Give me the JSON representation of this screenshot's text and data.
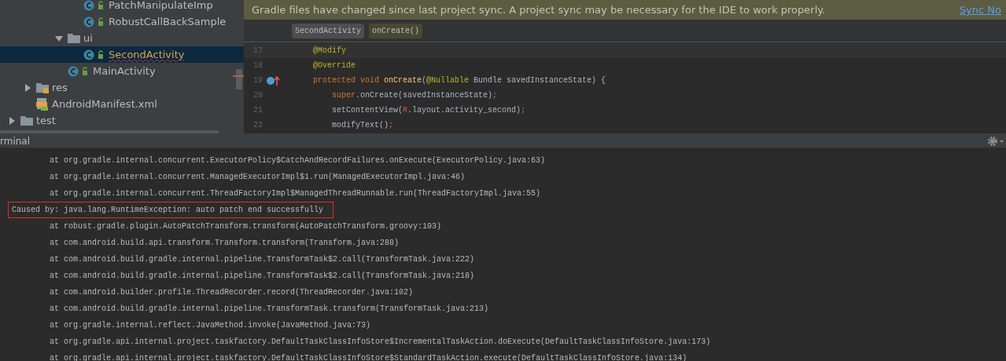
{
  "project_tree": {
    "items": [
      {
        "children": [
          {
            "children": [
              {
                "children": [
                  {
                    "children": [
                      {
                        "kind": "class",
                        "label": "PatchManipulateImp",
                        "selected": false
                      },
                      {
                        "kind": "class",
                        "label": "RobustCallBackSample",
                        "selected": false
                      }
                    ]
                  },
                  {
                    "kind": "folder",
                    "label": "ui",
                    "expanded": true,
                    "selected": false,
                    "children": [
                      {
                        "kind": "class",
                        "label": "SecondActivity",
                        "selected": true
                      }
                    ]
                  },
                  {
                    "kind": "class",
                    "label": "MainActivity",
                    "selected": false
                  }
                ]
              }
            ]
          },
          {
            "kind": "res",
            "label": "res",
            "expanded": false,
            "selected": false
          },
          {
            "kind": "manifest",
            "label": "AndroidManifest.xml",
            "selected": false
          }
        ]
      },
      {
        "kind": "folder",
        "label": "test",
        "expanded": false,
        "selected": false
      }
    ]
  },
  "banner": {
    "message": "Gradle files have changed since last project sync. A project sync may be necessary for the IDE to work properly.",
    "link": "Sync No"
  },
  "breadcrumbs": [
    {
      "kind": "class",
      "label": "SecondActivity"
    },
    {
      "kind": "method",
      "label": "onCreate()"
    }
  ],
  "code_lines": [
    {
      "number": "17",
      "current": true,
      "indented": false,
      "gutter_icon": false,
      "tokens": [
        {
          "kind": "annotation",
          "text": "@Modify"
        }
      ]
    },
    {
      "number": "18",
      "current": false,
      "indented": false,
      "gutter_icon": false,
      "tokens": [
        {
          "kind": "annotation",
          "text": "@Override"
        }
      ]
    },
    {
      "number": "19",
      "current": false,
      "indented": false,
      "gutter_icon": true,
      "tokens": [
        {
          "kind": "keyword",
          "text": "protected void "
        },
        {
          "kind": "method",
          "text": "onCreate"
        },
        {
          "kind": "plain",
          "text": "("
        },
        {
          "kind": "annotation",
          "text": "@Nullable"
        },
        {
          "kind": "plain",
          "text": " Bundle savedInstanceState) {"
        }
      ]
    },
    {
      "number": "20",
      "current": false,
      "indented": true,
      "gutter_icon": false,
      "tokens": [
        {
          "kind": "keyword",
          "text": "super"
        },
        {
          "kind": "plain",
          "text": ".onCreate(savedInstanceState)"
        },
        {
          "kind": "keyword",
          "text": ";"
        }
      ]
    },
    {
      "number": "21",
      "current": false,
      "indented": true,
      "gutter_icon": false,
      "tokens": [
        {
          "kind": "plain",
          "text": "setContentView("
        },
        {
          "kind": "error",
          "text": "R"
        },
        {
          "kind": "plain",
          "text": ".layout.activity_second)"
        },
        {
          "kind": "keyword",
          "text": ";"
        }
      ]
    },
    {
      "number": "22",
      "current": false,
      "indented": true,
      "gutter_icon": false,
      "tokens": [
        {
          "kind": "plain",
          "text": "modifyText()"
        },
        {
          "kind": "keyword",
          "text": ";"
        }
      ]
    }
  ],
  "terminal": {
    "title": "rminal",
    "lines": [
      {
        "kind": "frame",
        "text": "at org.gradle.internal.concurrent.ExecutorPolicy$CatchAndRecordFailures.onExecute(ExecutorPolicy.java:63)"
      },
      {
        "kind": "frame",
        "text": "at org.gradle.internal.concurrent.ManagedExecutorImpl$1.run(ManagedExecutorImpl.java:46)"
      },
      {
        "kind": "frame",
        "text": "at org.gradle.internal.concurrent.ThreadFactoryImpl$ManagedThreadRunnable.run(ThreadFactoryImpl.java:55)"
      },
      {
        "kind": "cause",
        "text": "Caused by: java.lang.RuntimeException: auto patch end successfully"
      },
      {
        "kind": "frame",
        "text": "at robust.gradle.plugin.AutoPatchTransform.transform(AutoPatchTransform.groovy:103)"
      },
      {
        "kind": "frame",
        "text": "at com.android.build.api.transform.Transform.transform(Transform.java:288)"
      },
      {
        "kind": "frame",
        "text": "at com.android.build.gradle.internal.pipeline.TransformTask$2.call(TransformTask.java:222)"
      },
      {
        "kind": "frame",
        "text": "at com.android.build.gradle.internal.pipeline.TransformTask$2.call(TransformTask.java:218)"
      },
      {
        "kind": "frame",
        "text": "at com.android.builder.profile.ThreadRecorder.record(ThreadRecorder.java:102)"
      },
      {
        "kind": "frame",
        "text": "at com.android.build.gradle.internal.pipeline.TransformTask.transform(TransformTask.java:213)"
      },
      {
        "kind": "frame",
        "text": "at org.gradle.internal.reflect.JavaMethod.invoke(JavaMethod.java:73)"
      },
      {
        "kind": "frame",
        "text": "at org.gradle.api.internal.project.taskfactory.DefaultTaskClassInfoStore$IncrementalTaskAction.doExecute(DefaultTaskClassInfoStore.java:173)"
      },
      {
        "kind": "frame",
        "text": "at org.gradle.api.internal.project.taskfactory.DefaultTaskClassInfoStore$StandardTaskAction.execute(DefaultTaskClassInfoStore.java:134)"
      }
    ]
  }
}
